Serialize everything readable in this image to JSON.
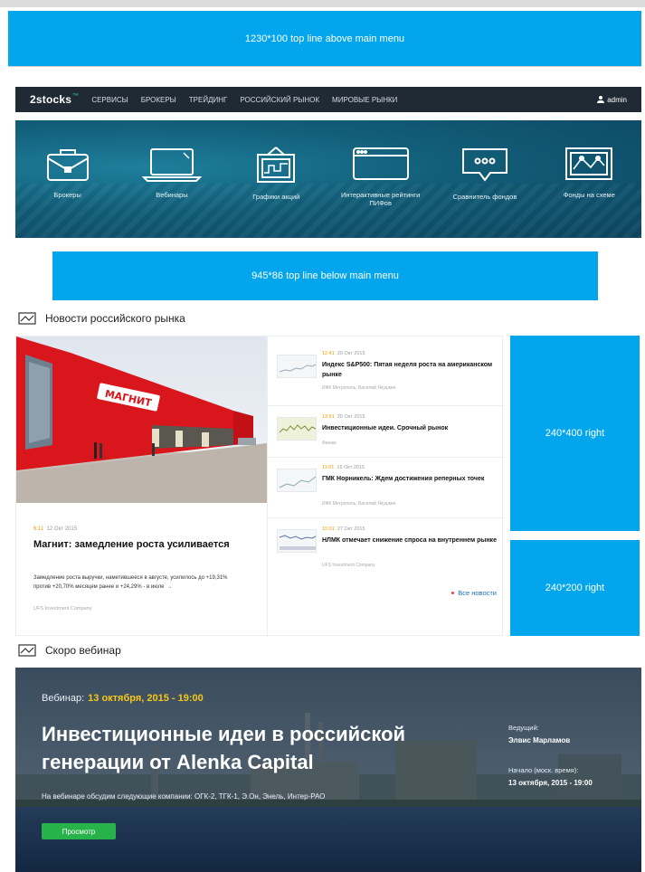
{
  "ads": {
    "top": "1230*100 top line above main menu",
    "below": "945*86 top line below main menu",
    "right1": "240*400 right",
    "right2": "240*200 right"
  },
  "nav": {
    "logo": "2stocks",
    "logo_sup": "™",
    "items": [
      "СЕРВИСЫ",
      "БРОКЕРЫ",
      "ТРЕЙДИНГ",
      "РОССИЙСКИЙ РЫНОК",
      "МИРОВЫЕ РЫНКИ"
    ],
    "user": "admin"
  },
  "hero": {
    "items": [
      {
        "label": "Брокеры",
        "icon": "briefcase-icon"
      },
      {
        "label": "Вебинары",
        "icon": "laptop-icon"
      },
      {
        "label": "Графики акций",
        "icon": "chart-board-icon"
      },
      {
        "label": "Интерактивные рейтинги ПИФов",
        "icon": "browser-window-icon"
      },
      {
        "label": "Сравнитель фондов",
        "icon": "chat-bubble-icon"
      },
      {
        "label": "Фонды на схеме",
        "icon": "line-chart-icon"
      }
    ]
  },
  "news_section": {
    "title": "Новости российского рынка",
    "featured": {
      "time": "6:11",
      "date": "12 Окт 2015",
      "title": "Магнит: замедление роста усиливается",
      "text": "Замедление роста выручки, наметившееся в августе, усилилось до +19,31% против +20,70% месяцем ранее и +24,29% - в июле",
      "more": "→",
      "source": "UFS Investment Company",
      "banner_text": "МАГНИТ"
    },
    "items": [
      {
        "time": "12:41",
        "date": "20 Окт 2015",
        "title": "Индекс S&P500: Пятая неделя роста на американском рынке",
        "source": "ИФК Метрополь, Василий Якушкин"
      },
      {
        "time": "13:51",
        "date": "20 Окт 2015",
        "title": "Инвестиционные идеи. Срочный рынок",
        "source": "Финам"
      },
      {
        "time": "11:01",
        "date": "15 Окт 2015",
        "title": "ГМК Норникель: Ждем достижения реперных точек",
        "source": "ИФК Метрополь, Василий Якушкин"
      },
      {
        "time": "15:01",
        "date": "27 Окт 2015",
        "title": "НЛМК отмечает снижение спроса на внутреннем рынке",
        "source": "UFS Investment Company"
      }
    ],
    "all_news": "Все новости"
  },
  "webinar_section": {
    "title": "Скоро вебинар",
    "label": "Вебинар:",
    "date": "13 октября, 2015 - 19:00",
    "headline": "Инвестиционные идеи в российской генерации от Alenka Capital",
    "description": "На вебинаре обсудим следующие компании: ОГК-2, ТГК-1, Э.Он, Энель, Интер-РАО",
    "button": "Просмотр",
    "host_label": "Ведущий:",
    "host_name": "Элвис Марламов",
    "start_label": "Начало (моск. время):",
    "start_value": "13 октября, 2015 - 19:00"
  }
}
